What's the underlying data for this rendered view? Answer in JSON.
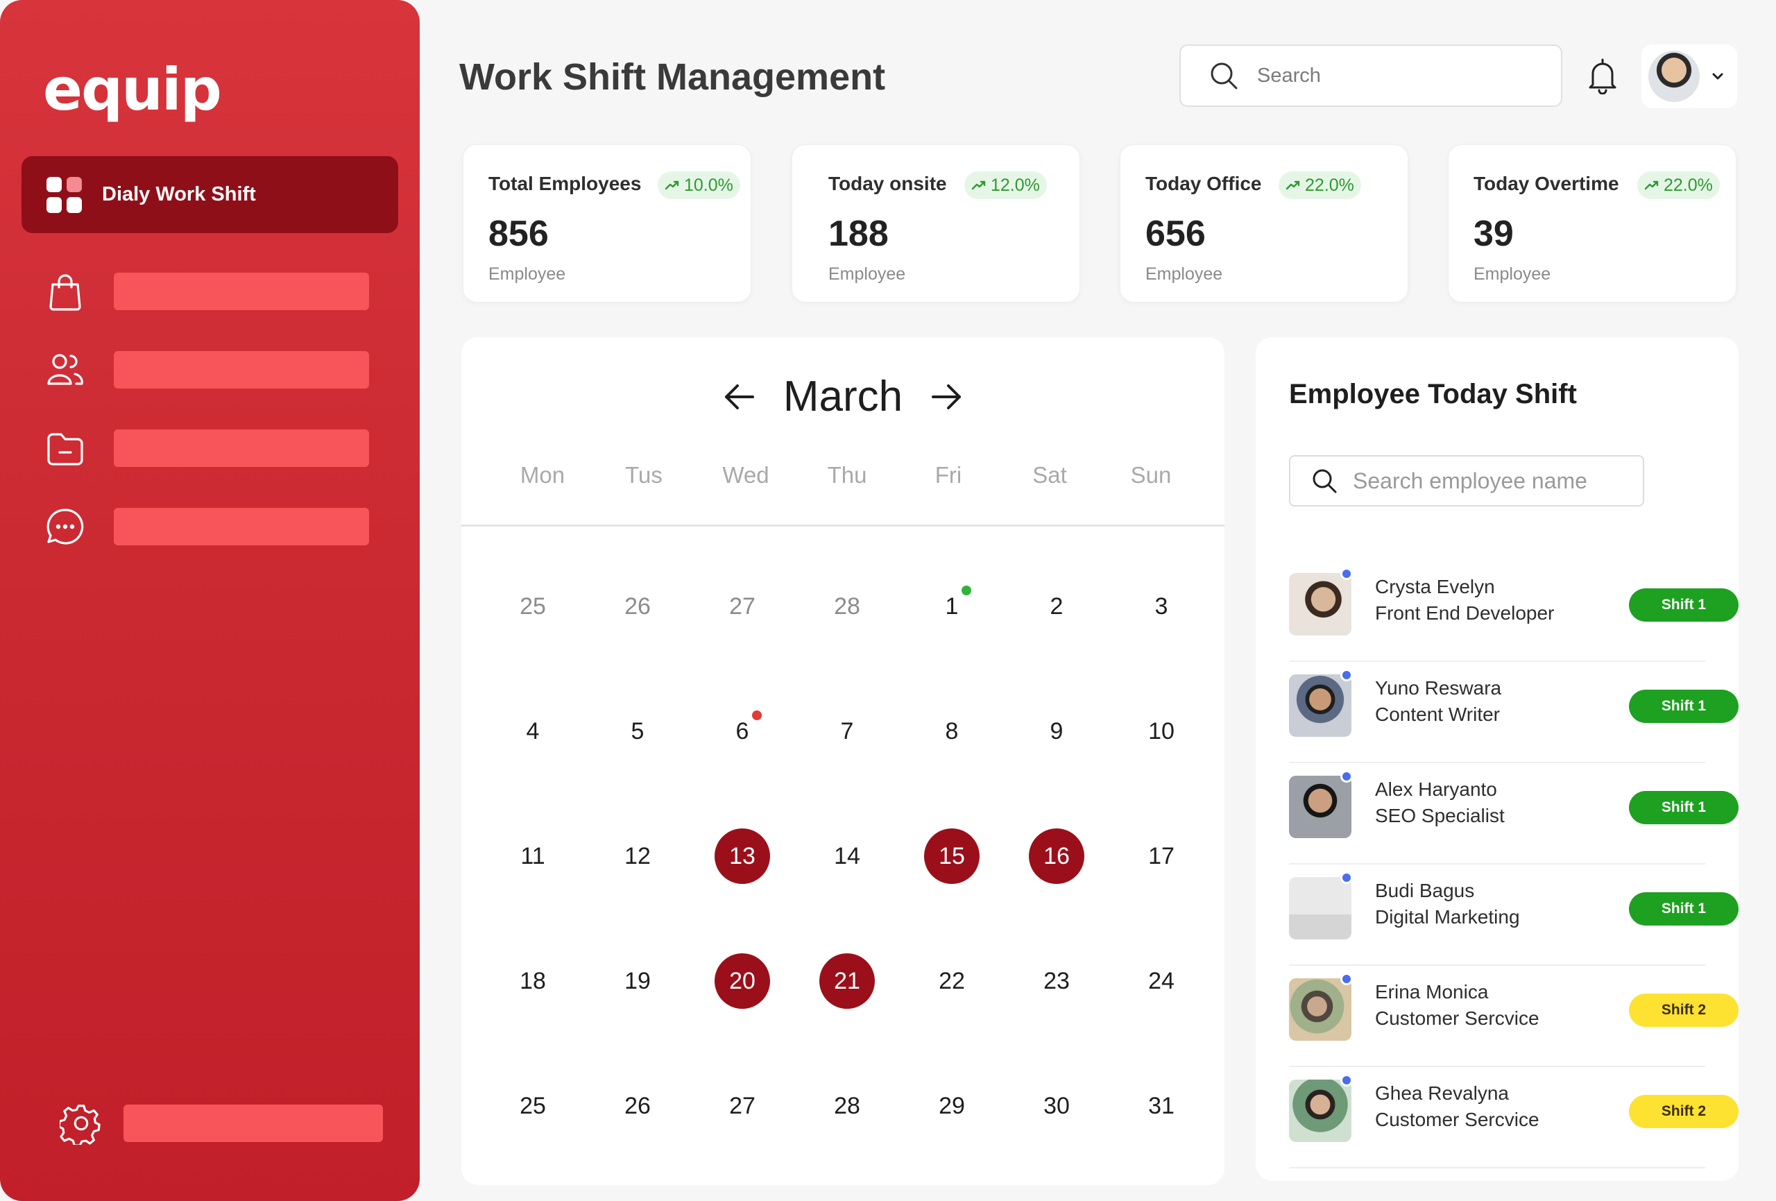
{
  "app": {
    "logo": "equip",
    "page_title": "Work Shift Management"
  },
  "sidebar": {
    "active_item": "Dialy Work Shift",
    "items": [
      {
        "icon": "shopping-bag-icon"
      },
      {
        "icon": "users-icon"
      },
      {
        "icon": "folder-icon"
      },
      {
        "icon": "chat-icon"
      }
    ],
    "settings_icon": "gear-icon"
  },
  "header": {
    "search_placeholder": "Search",
    "notification_icon": "bell-icon"
  },
  "stats": [
    {
      "title": "Total Employees",
      "change": "10.0%",
      "value": "856",
      "unit": "Employee"
    },
    {
      "title": "Today onsite",
      "change": "12.0%",
      "value": "188",
      "unit": "Employee"
    },
    {
      "title": "Today Office",
      "change": "22.0%",
      "value": "656",
      "unit": "Employee"
    },
    {
      "title": "Today Overtime",
      "change": "22.0%",
      "value": "39",
      "unit": "Employee"
    }
  ],
  "calendar": {
    "month": "March",
    "weekdays": [
      "Mon",
      "Tus",
      "Wed",
      "Thu",
      "Fri",
      "Sat",
      "Sun"
    ],
    "weeks": [
      [
        "25",
        "26",
        "27",
        "28",
        "1",
        "2",
        "3"
      ],
      [
        "4",
        "5",
        "6",
        "7",
        "8",
        "9",
        "10"
      ],
      [
        "11",
        "12",
        "13",
        "14",
        "15",
        "16",
        "17"
      ],
      [
        "18",
        "19",
        "20",
        "21",
        "22",
        "23",
        "24"
      ],
      [
        "25",
        "26",
        "27",
        "28",
        "29",
        "30",
        "31"
      ]
    ],
    "muted_first_week_count": 4,
    "highlighted": [
      "13",
      "15",
      "16",
      "20",
      "21"
    ],
    "marker_green": "1",
    "marker_red": "6",
    "colors": {
      "highlight": "#9b0f1a",
      "green_dot": "#2fb33a",
      "red_dot": "#e53935"
    }
  },
  "employees_panel": {
    "title": "Employee Today Shift",
    "search_placeholder": "Search employee name",
    "employees": [
      {
        "name": "Crysta Evelyn",
        "role": "Front End Developer",
        "shift": "Shift 1",
        "type": "s1"
      },
      {
        "name": "Yuno Reswara",
        "role": "Content Writer",
        "shift": "Shift 1",
        "type": "s1"
      },
      {
        "name": "Alex Haryanto",
        "role": "SEO Specialist",
        "shift": "Shift 1",
        "type": "s1"
      },
      {
        "name": "Budi Bagus",
        "role": "Digital Marketing",
        "shift": "Shift 1",
        "type": "s1"
      },
      {
        "name": "Erina Monica",
        "role": "Customer Sercvice",
        "shift": "Shift 2",
        "type": "s2"
      },
      {
        "name": "Ghea Revalyna",
        "role": "Customer Sercvice",
        "shift": "Shift 2",
        "type": "s2"
      }
    ]
  }
}
